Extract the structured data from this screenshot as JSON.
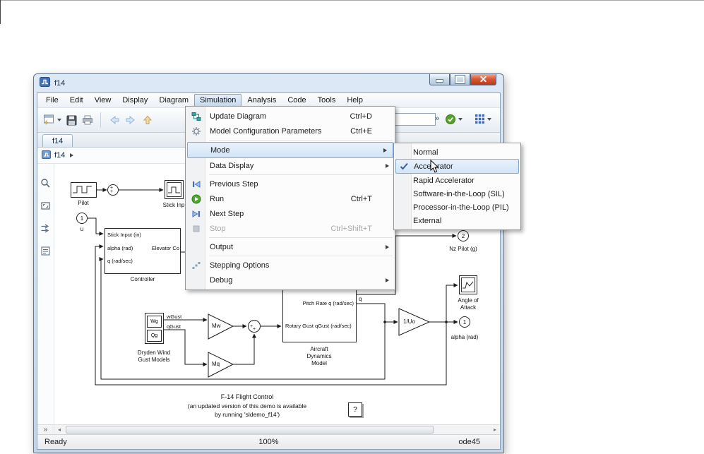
{
  "window": {
    "title": "f14"
  },
  "menubar": {
    "items": [
      "File",
      "Edit",
      "View",
      "Display",
      "Diagram",
      "Simulation",
      "Analysis",
      "Code",
      "Tools",
      "Help"
    ]
  },
  "toolbar": {
    "overflow": "»"
  },
  "tabs": {
    "active": "f14"
  },
  "breadcrumb": {
    "path": "f14"
  },
  "leftbar": {
    "overflow": "»"
  },
  "statusbar": {
    "ready": "Ready",
    "zoom": "100%",
    "solver": "ode45"
  },
  "simulation_menu": {
    "items": [
      {
        "label": "Update Diagram",
        "shortcut": "Ctrl+D"
      },
      {
        "label": "Model Configuration Parameters",
        "shortcut": "Ctrl+E"
      },
      {
        "label": "Mode",
        "submenu": true,
        "highlighted": true
      },
      {
        "label": "Data Display",
        "submenu": true
      },
      {
        "label": "Previous Step"
      },
      {
        "label": "Run",
        "shortcut": "Ctrl+T"
      },
      {
        "label": "Next Step"
      },
      {
        "label": "Stop",
        "shortcut": "Ctrl+Shift+T",
        "disabled": true
      },
      {
        "label": "Output",
        "submenu": true
      },
      {
        "label": "Stepping Options"
      },
      {
        "label": "Debug",
        "submenu": true
      }
    ]
  },
  "mode_submenu": {
    "items": [
      {
        "label": "Normal"
      },
      {
        "label": "Accelerator",
        "checked": true,
        "highlighted": true
      },
      {
        "label": "Rapid Accelerator"
      },
      {
        "label": "Software-in-the-Loop (SIL)"
      },
      {
        "label": "Processor-in-the-Loop (PIL)"
      },
      {
        "label": "External"
      }
    ]
  },
  "diagram": {
    "pilot_label": "Pilot",
    "sum1_sign_top": "+",
    "sum1_sign_bottom": "+",
    "stick_scope_label": "Stick Inp",
    "inport_u_num": "1",
    "inport_u_label": "u",
    "controller_port_stick": "Stick Input (in)",
    "controller_port_alpha": "alpha (rad)",
    "controller_port_elevator": "Elevator Co",
    "controller_port_q": "q (rad/sec)",
    "controller_label": "Controller",
    "dryden_wg": "Wg",
    "dryden_qg": "Qg",
    "dryden_label1": "Dryden Wind",
    "dryden_label2": "Gust Models",
    "signal_wgust": "wGust",
    "signal_qgust": "qGust",
    "gain_mw": "Mw",
    "gain_mq": "Mq",
    "sum2_sign_left": "+",
    "sum2_sign_bottom": "+",
    "aircraft_port_q": "Pitch Rate q (rad/sec)",
    "aircraft_port_gust": "Rotary Gust qGust (rad/sec)",
    "aircraft_label1": "Aircraft",
    "aircraft_label2": "Dynamics",
    "aircraft_label3": "Model",
    "signal_q": "q",
    "gain_uo": "1/Uo",
    "outport_alpha_num": "1",
    "outport_alpha_label": "alpha (rad)",
    "outport_nz_num": "2",
    "outport_nz_label": "Nz Pilot (g)",
    "aoa_scope_label1": "Angle of",
    "aoa_scope_label2": "Attack",
    "info_label": "?",
    "caption1": "F-14 Flight Control",
    "caption2": "(an updated version of this demo is available",
    "caption3": "by running 'sldemo_f14')"
  },
  "colors": {
    "titlebar_blue": "#c3d4e8",
    "close_red": "#bf3716",
    "menu_highlight": "#d2e4f7",
    "run_green": "#4ea72e",
    "accent_blue": "#3e6db5"
  },
  "icons": {
    "simulink-app-icon": "blue square with white step signal",
    "update-diagram-icon": "teal linked blocks",
    "gear-icon": "gray gear",
    "step-back-icon": "blue bar + left triangle",
    "run-icon": "green circle white play",
    "step-forward-icon": "right triangle + blue bar",
    "stop-icon": "gray square",
    "stepping-options-icon": "gray stairs",
    "check-icon": "blue checkmark",
    "green-check-icon": "green circle white check",
    "build-grid-icon": "blue 3x3 dot grid",
    "zoom-icon": "magnifier",
    "fit-view-icon": "rectangle with diagonal arrows",
    "pan-arrows-icon": "two right arrows",
    "annotation-icon": "boxed text lines",
    "cursor-icon": "arrow pointer"
  }
}
